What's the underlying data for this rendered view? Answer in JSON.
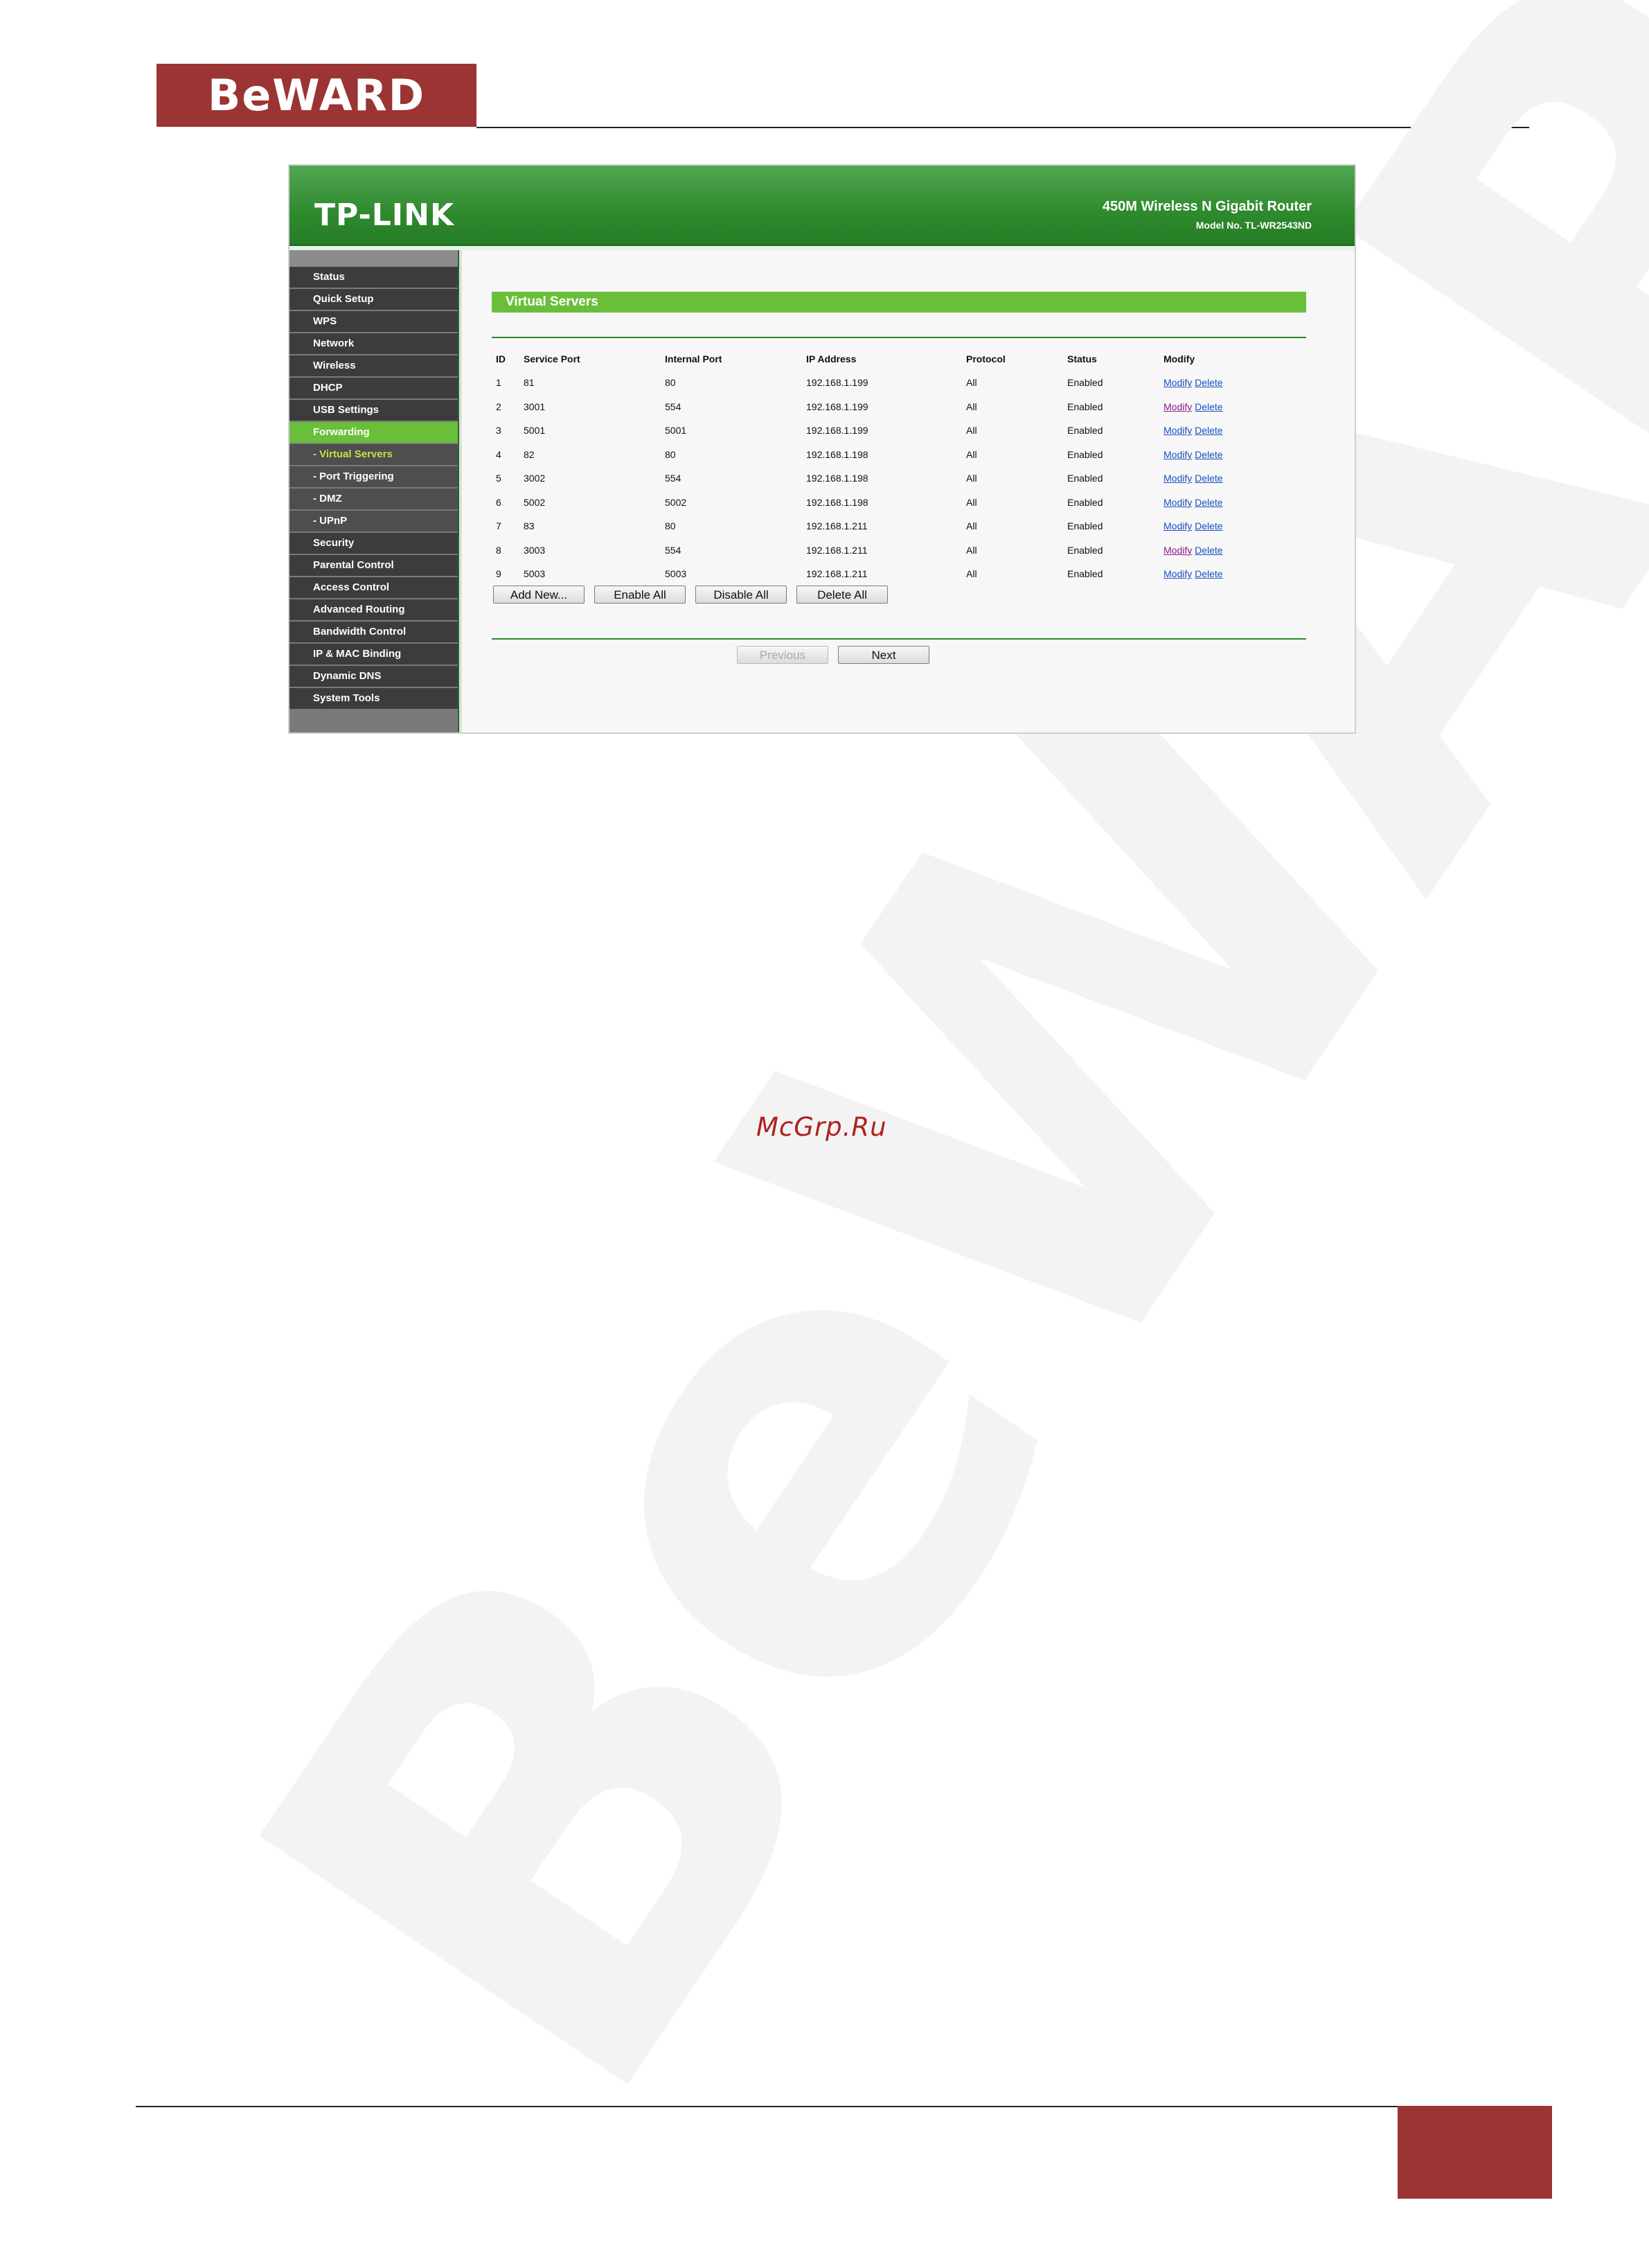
{
  "brand": {
    "logo_text": "BeWARD",
    "accent_color": "#9b3434",
    "watermark_text": "BeWARD"
  },
  "router": {
    "logo": "TP-LINK",
    "model_title": "450M Wireless N Gigabit Router",
    "model_number": "Model No. TL-WR2543ND",
    "header_color": "#2f8a2e",
    "active_color": "#6abf3a"
  },
  "sidebar": {
    "items": [
      {
        "label": "Status"
      },
      {
        "label": "Quick Setup"
      },
      {
        "label": "WPS"
      },
      {
        "label": "Network"
      },
      {
        "label": "Wireless"
      },
      {
        "label": "DHCP"
      },
      {
        "label": "USB Settings"
      },
      {
        "label": "Forwarding"
      },
      {
        "label": "- Virtual Servers"
      },
      {
        "label": "- Port Triggering"
      },
      {
        "label": "- DMZ"
      },
      {
        "label": "- UPnP"
      },
      {
        "label": "Security"
      },
      {
        "label": "Parental Control"
      },
      {
        "label": "Access Control"
      },
      {
        "label": "Advanced Routing"
      },
      {
        "label": "Bandwidth Control"
      },
      {
        "label": "IP & MAC Binding"
      },
      {
        "label": "Dynamic DNS"
      },
      {
        "label": "System Tools"
      }
    ]
  },
  "page": {
    "title": "Virtual Servers",
    "columns": [
      "ID",
      "Service Port",
      "Internal Port",
      "IP Address",
      "Protocol",
      "Status",
      "Modify"
    ],
    "rows": [
      {
        "id": "1",
        "service_port": "81",
        "internal_port": "80",
        "ip": "192.168.1.199",
        "protocol": "All",
        "status": "Enabled"
      },
      {
        "id": "2",
        "service_port": "3001",
        "internal_port": "554",
        "ip": "192.168.1.199",
        "protocol": "All",
        "status": "Enabled"
      },
      {
        "id": "3",
        "service_port": "5001",
        "internal_port": "5001",
        "ip": "192.168.1.199",
        "protocol": "All",
        "status": "Enabled"
      },
      {
        "id": "4",
        "service_port": "82",
        "internal_port": "80",
        "ip": "192.168.1.198",
        "protocol": "All",
        "status": "Enabled"
      },
      {
        "id": "5",
        "service_port": "3002",
        "internal_port": "554",
        "ip": "192.168.1.198",
        "protocol": "All",
        "status": "Enabled"
      },
      {
        "id": "6",
        "service_port": "5002",
        "internal_port": "5002",
        "ip": "192.168.1.198",
        "protocol": "All",
        "status": "Enabled"
      },
      {
        "id": "7",
        "service_port": "83",
        "internal_port": "80",
        "ip": "192.168.1.211",
        "protocol": "All",
        "status": "Enabled"
      },
      {
        "id": "8",
        "service_port": "3003",
        "internal_port": "554",
        "ip": "192.168.1.211",
        "protocol": "All",
        "status": "Enabled"
      },
      {
        "id": "9",
        "service_port": "5003",
        "internal_port": "5003",
        "ip": "192.168.1.211",
        "protocol": "All",
        "status": "Enabled"
      }
    ],
    "modify_label": "Modify",
    "delete_label": "Delete",
    "buttons": {
      "add_new": "Add New...",
      "enable_all": "Enable All",
      "disable_all": "Disable All",
      "delete_all": "Delete All"
    },
    "pager": {
      "previous": "Previous",
      "next": "Next"
    }
  },
  "site_label": "McGrp.Ru"
}
